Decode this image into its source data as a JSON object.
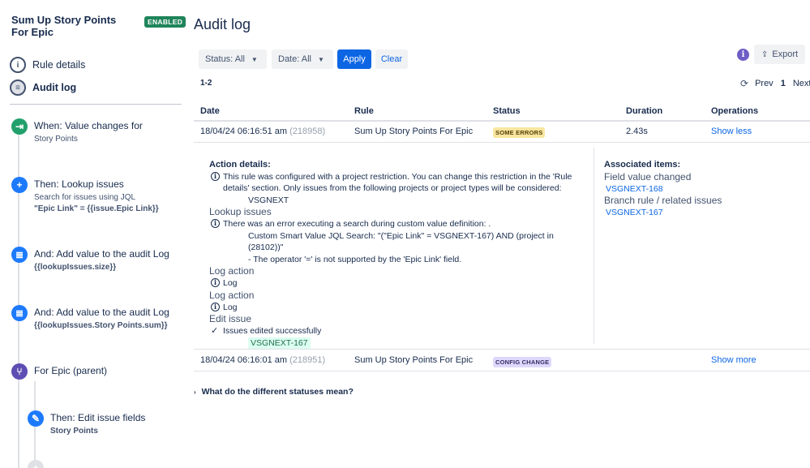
{
  "rule": {
    "title": "Sum Up Story Points For Epic",
    "status_badge": "ENABLED"
  },
  "nav": {
    "rule_details": "Rule details",
    "audit_log": "Audit log"
  },
  "steps": [
    {
      "title": "When: Value changes for",
      "sub1": "Story Points",
      "sub2": "",
      "color": "#22a06b"
    },
    {
      "title": "Then: Lookup issues",
      "sub1": "Search for issues using JQL",
      "sub2": "\"Epic Link\" = {{issue.Epic Link}}",
      "color": "#1d7afc"
    },
    {
      "title": "And: Add value to the audit Log",
      "sub1": "{{lookupIssues.size}}",
      "sub2": "",
      "color": "#1d7afc"
    },
    {
      "title": "And: Add value to the audit Log",
      "sub1": "{{lookupIssues.Story Points.sum}}",
      "sub2": "",
      "color": "#1d7afc"
    },
    {
      "title": "For Epic (parent)",
      "sub1": "",
      "sub2": "",
      "color": "#5e4db2"
    },
    {
      "title": "Then: Edit issue fields",
      "sub1": "Story Points",
      "sub2": "",
      "color": "#1d7afc"
    }
  ],
  "main": {
    "title": "Audit log",
    "filters": {
      "status": "Status: All",
      "date": "Date: All",
      "apply": "Apply",
      "clear": "Clear"
    },
    "export": "Export",
    "range": "1-2",
    "pager": {
      "prev": "Prev",
      "page": "1",
      "next": "Next"
    },
    "columns": [
      "Date",
      "Rule",
      "Status",
      "Duration",
      "Operations"
    ],
    "rows": [
      {
        "date": "18/04/24 06:16:51 am",
        "id": "(218958)",
        "rule": "Sum Up Story Points For Epic",
        "status": "SOME ERRORS",
        "duration": "2.43s",
        "op": "Show less"
      },
      {
        "date": "18/04/24 06:16:01 am",
        "id": "(218951)",
        "rule": "Sum Up Story Points For Epic",
        "status": "CONFIG CHANGE",
        "duration": "",
        "op": "Show more"
      }
    ],
    "details": {
      "heading": "Action details:",
      "restriction_line1": "This rule was configured with a project restriction. You can change this restriction in the 'Rule",
      "restriction_line2": "details' section. Only issues from the following projects or project types will be considered:",
      "restriction_project": "VSGNEXT",
      "lookup_heading": "Lookup issues",
      "lookup_error": "There was an error executing a search during custom value definition: .",
      "lookup_jql": "Custom Smart Value JQL Search: \"(\"Epic Link\" = VSGNEXT-167) AND (project in (28102))\"",
      "lookup_reason": "- The operator '=' is not supported by the 'Epic Link' field.",
      "log1_heading": "Log action",
      "log1_text": "Log",
      "log2_heading": "Log action",
      "log2_text": "Log",
      "edit_heading": "Edit issue",
      "edit_text": "Issues edited successfully",
      "edit_issue": "VSGNEXT-167"
    },
    "associated": {
      "heading": "Associated items:",
      "group1": "Field value changed",
      "group1_item": "VSGNEXT-168",
      "group2": "Branch rule / related issues",
      "group2_item": "VSGNEXT-167"
    },
    "faq": "What do the different statuses mean?"
  }
}
